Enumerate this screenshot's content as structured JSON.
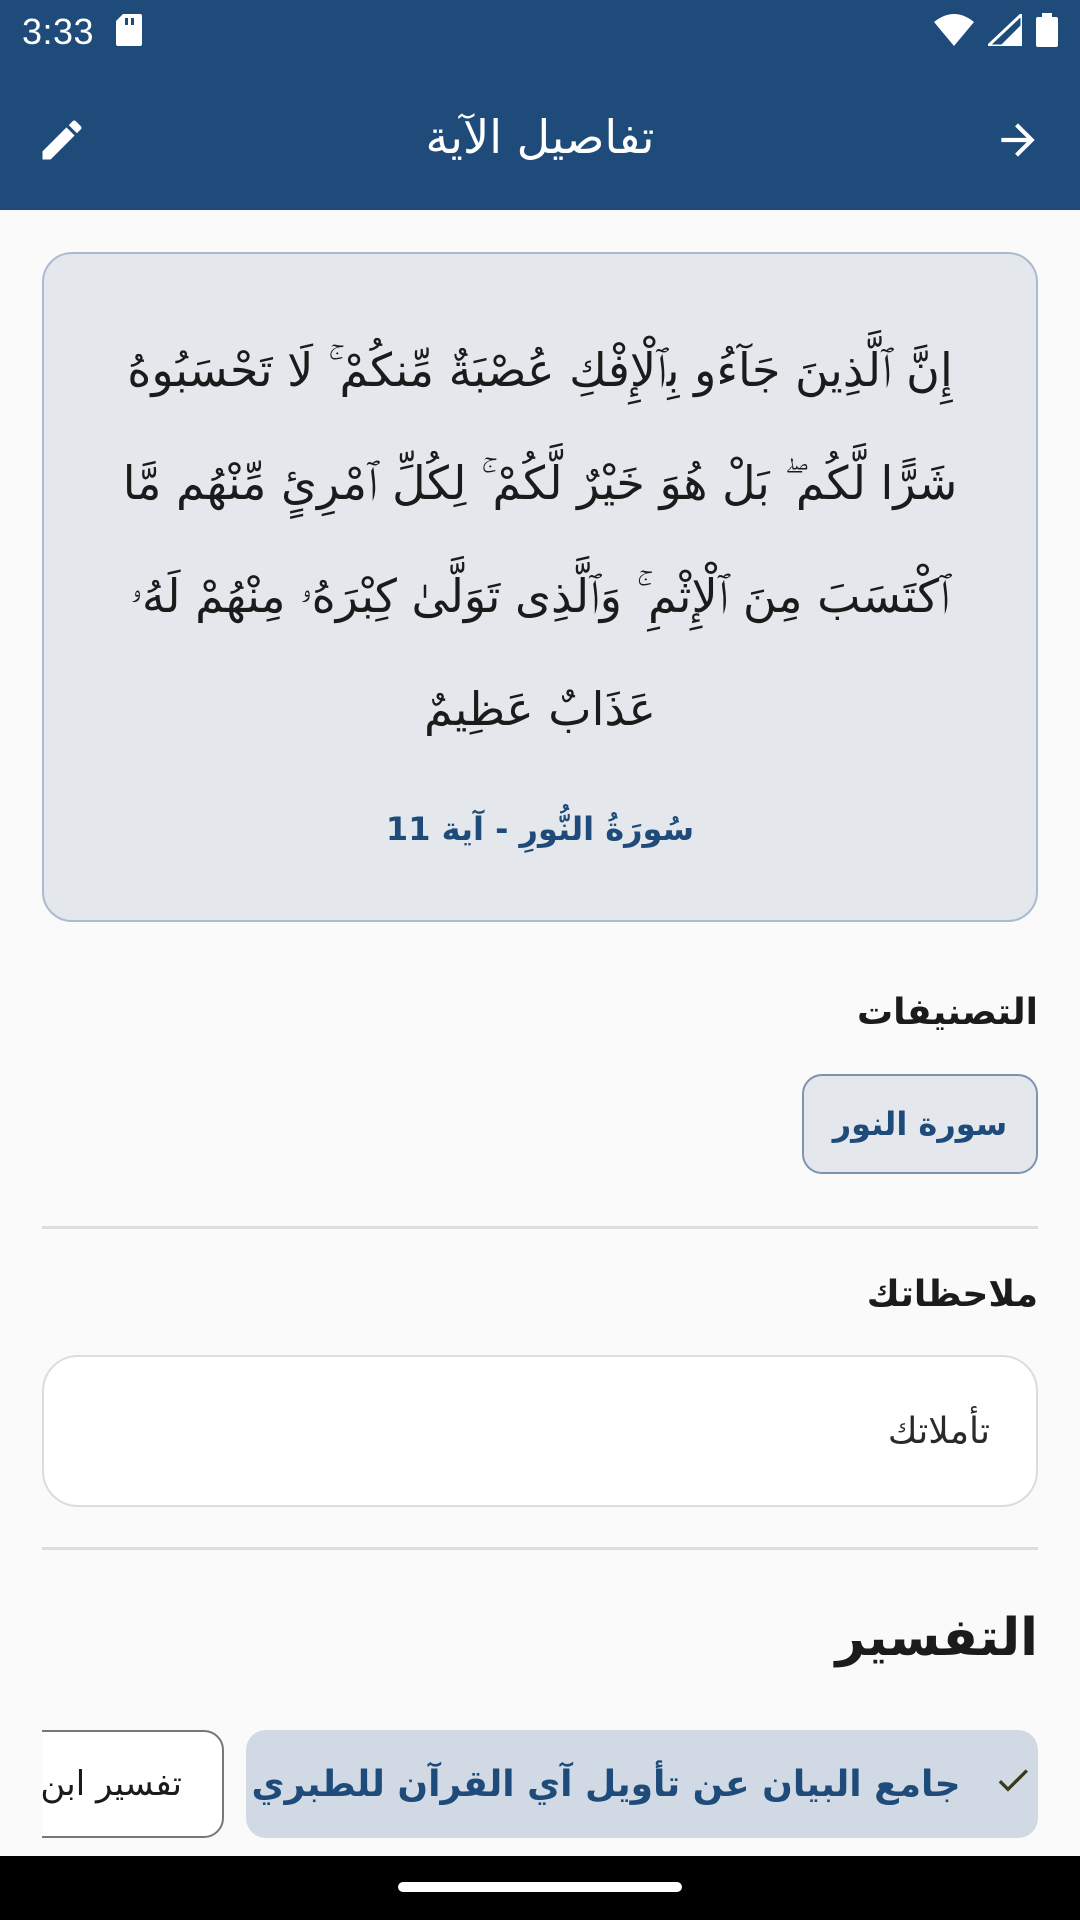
{
  "status_bar": {
    "time": "3:33",
    "icons": [
      "sd-card-icon",
      "wifi-icon",
      "signal-icon",
      "battery-icon"
    ]
  },
  "app_bar": {
    "title": "تفاصيل الآية",
    "left_icon": "edit-icon",
    "right_icon": "arrow-forward-icon"
  },
  "ayah": {
    "text": "إِنَّ ٱلَّذِينَ جَآءُو بِٱلْإِفْكِ عُصْبَةٌ مِّنكُمْ ۚ لَا تَحْسَبُوهُ شَرًّا لَّكُم ۖ بَلْ هُوَ خَيْرٌ لَّكُمْ ۚ لِكُلِّ ٱمْرِئٍ مِّنْهُم مَّا ٱكْتَسَبَ مِنَ ٱلْإِثْمِ ۚ وَٱلَّذِى تَوَلَّىٰ كِبْرَهُۥ مِنْهُمْ لَهُۥ عَذَابٌ عَظِيمٌ",
    "reference": "سُورَةُ النُّورِ - آية 11"
  },
  "categories": {
    "heading": "التصنيفات",
    "chips": [
      "سورة النور"
    ]
  },
  "notes": {
    "heading": "ملاحظاتك",
    "placeholder": "تأملاتك"
  },
  "tafsir": {
    "heading": "التفسير",
    "selected": "جامع البيان عن تأويل آي القرآن للطبري",
    "other": "تفسير ابن كثير"
  },
  "colors": {
    "primary": "#1e4b7a",
    "card_bg": "#e4e8ed",
    "selected_chip_bg": "#d0d9e4"
  }
}
